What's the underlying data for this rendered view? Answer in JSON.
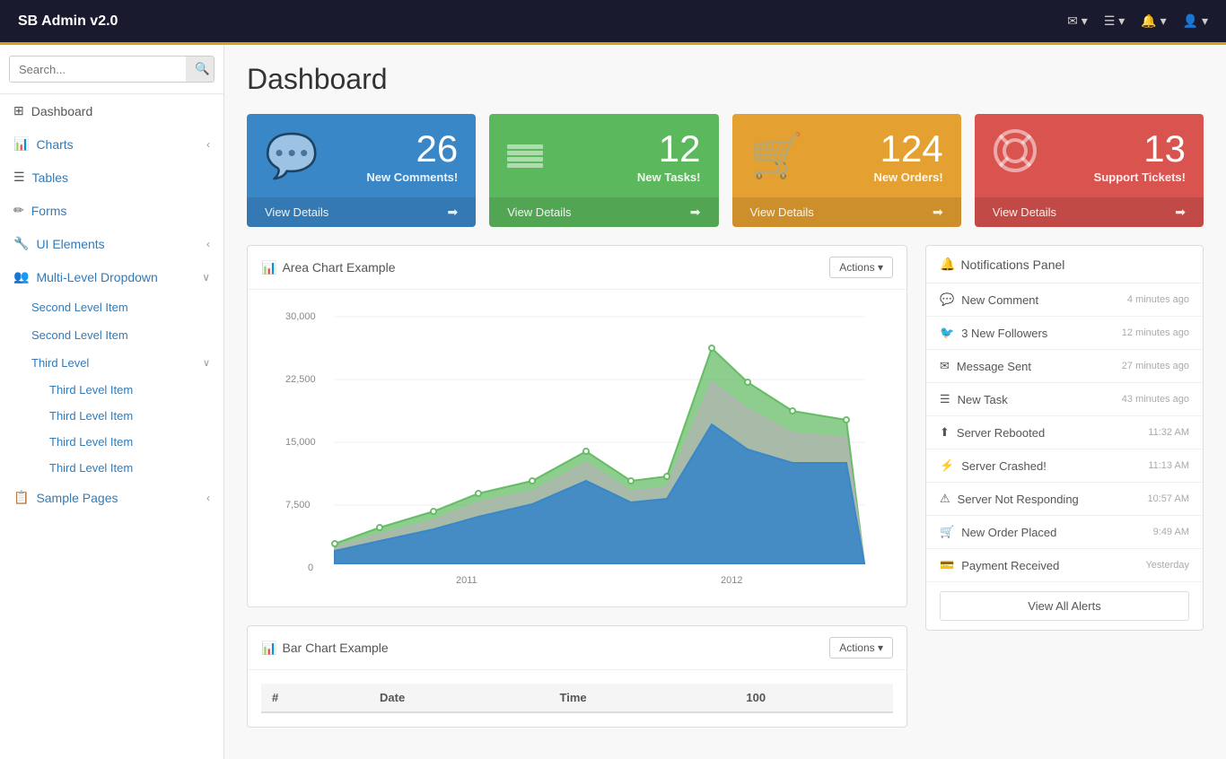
{
  "app": {
    "title": "SB Admin v2.0",
    "brand": "SB Admin v2.0"
  },
  "topnav": {
    "icons": [
      {
        "id": "email-icon",
        "symbol": "✉",
        "label": "Email",
        "badge": ""
      },
      {
        "id": "tasks-icon",
        "symbol": "☰",
        "label": "Tasks",
        "badge": ""
      },
      {
        "id": "alerts-icon",
        "symbol": "🔔",
        "label": "Alerts",
        "badge": ""
      },
      {
        "id": "user-icon",
        "symbol": "👤",
        "label": "User",
        "badge": ""
      }
    ]
  },
  "sidebar": {
    "search_placeholder": "Search...",
    "search_button_label": "🔍",
    "nav_items": [
      {
        "id": "dashboard",
        "icon": "⊞",
        "label": "Dashboard",
        "has_children": false
      },
      {
        "id": "charts",
        "icon": "📊",
        "label": "Charts",
        "has_children": true
      },
      {
        "id": "tables",
        "icon": "☰",
        "label": "Tables",
        "has_children": false
      },
      {
        "id": "forms",
        "icon": "✏",
        "label": "Forms",
        "has_children": false
      },
      {
        "id": "ui-elements",
        "icon": "🔧",
        "label": "UI Elements",
        "has_children": true
      },
      {
        "id": "multi-level",
        "icon": "👥",
        "label": "Multi-Level Dropdown",
        "has_children": true
      }
    ],
    "multi_level": {
      "second_level_items": [
        "Second Level Item",
        "Second Level Item"
      ],
      "third_level": {
        "label": "Third Level",
        "items": [
          "Third Level Item",
          "Third Level Item",
          "Third Level Item",
          "Third Level Item"
        ]
      }
    },
    "sample_pages": {
      "label": "Sample Pages",
      "icon": "📋",
      "has_children": true
    }
  },
  "page": {
    "title": "Dashboard"
  },
  "stat_cards": [
    {
      "id": "comments",
      "color_class": "card-blue",
      "icon": "💬",
      "value": "26",
      "label": "New Comments!",
      "link": "View Details"
    },
    {
      "id": "tasks",
      "color_class": "card-green",
      "icon": "☰",
      "value": "12",
      "label": "New Tasks!",
      "link": "View Details"
    },
    {
      "id": "orders",
      "color_class": "card-orange",
      "icon": "🛒",
      "value": "124",
      "label": "New Orders!",
      "link": "View Details"
    },
    {
      "id": "tickets",
      "color_class": "card-red",
      "icon": "🔴",
      "value": "13",
      "label": "Support Tickets!",
      "link": "View Details"
    }
  ],
  "area_chart": {
    "title": "Area Chart Example",
    "actions_label": "Actions ▾",
    "y_labels": [
      "30,000",
      "22,500",
      "15,000",
      "7,500",
      "0"
    ],
    "x_labels": [
      "2011",
      "2012"
    ],
    "series": {
      "green": [
        1800,
        3500,
        5000,
        7500,
        9000,
        13000,
        9000,
        10000,
        26500,
        20000,
        16000,
        14000
      ],
      "gray": [
        1500,
        2800,
        4000,
        6000,
        7000,
        10000,
        7500,
        8500,
        20000,
        15500,
        13000,
        12500
      ],
      "blue": [
        1200,
        2200,
        3000,
        4500,
        5500,
        8000,
        6000,
        7000,
        15000,
        10000,
        9000,
        9500
      ]
    }
  },
  "bar_chart": {
    "title": "Bar Chart Example",
    "actions_label": "Actions ▾",
    "columns": [
      "#",
      "Date",
      "Time"
    ]
  },
  "notifications": {
    "panel_title": "Notifications Panel",
    "bell_icon": "🔔",
    "items": [
      {
        "icon": "💬",
        "text": "New Comment",
        "time": "4 minutes ago"
      },
      {
        "icon": "🐦",
        "text": "3 New Followers",
        "time": "12 minutes ago"
      },
      {
        "icon": "✉",
        "text": "Message Sent",
        "time": "27 minutes ago"
      },
      {
        "icon": "☰",
        "text": "New Task",
        "time": "43 minutes ago"
      },
      {
        "icon": "⬆",
        "text": "Server Rebooted",
        "time": "11:32 AM"
      },
      {
        "icon": "⚡",
        "text": "Server Crashed!",
        "time": "11:13 AM"
      },
      {
        "icon": "⚠",
        "text": "Server Not Responding",
        "time": "10:57 AM"
      },
      {
        "icon": "🛒",
        "text": "New Order Placed",
        "time": "9:49 AM"
      },
      {
        "icon": "💳",
        "text": "Payment Received",
        "time": "Yesterday"
      }
    ],
    "view_all_label": "View All Alerts"
  },
  "colors": {
    "accent": "#337ab7",
    "blue_card": "#3a87c8",
    "green_card": "#5cb85c",
    "orange_card": "#e4a030",
    "red_card": "#d9534f",
    "chart_green": "rgba(92,184,92,0.7)",
    "chart_gray": "rgba(180,180,180,0.7)",
    "chart_blue": "rgba(58,135,200,0.9)"
  }
}
